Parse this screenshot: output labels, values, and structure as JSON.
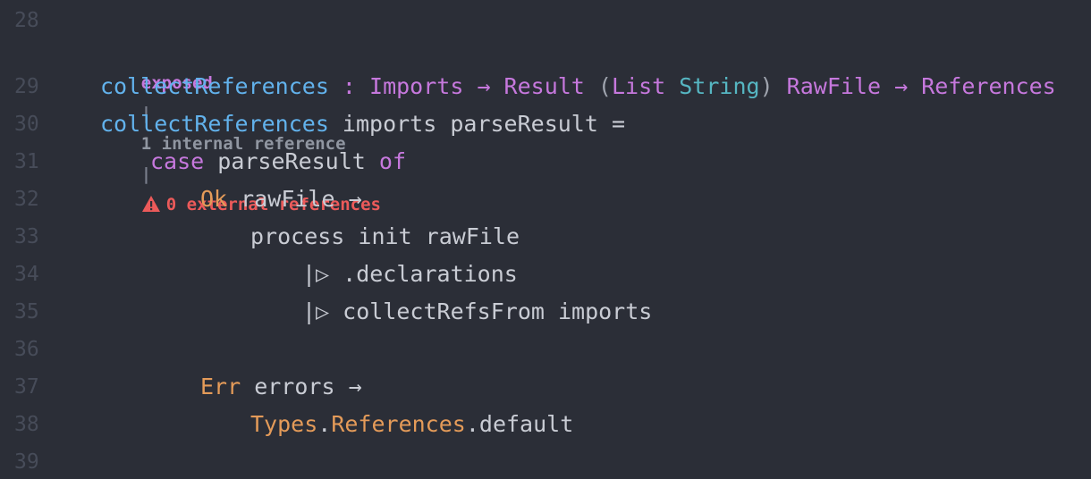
{
  "line_numbers": [
    "28",
    "29",
    "30",
    "31",
    "32",
    "33",
    "34",
    "35",
    "36",
    "37",
    "38",
    "39"
  ],
  "code_lens": {
    "exposed": "exposed",
    "separator": "|",
    "internal": "1 internal reference",
    "external": "0 external references",
    "warning_icon": "warning-triangle-icon",
    "warning_color": "#ec5a5a"
  },
  "code": {
    "l29": [
      "collectReferences",
      " : ",
      "Imports",
      " → ",
      "Result",
      " (",
      "List",
      " ",
      "String",
      ") ",
      "RawFile",
      " → ",
      "References"
    ],
    "l30": [
      "collectReferences",
      " imports parseResult ="
    ],
    "l31": [
      "case",
      " parseResult ",
      "of"
    ],
    "l32": [
      "Ok",
      " rawFile →"
    ],
    "l33": [
      "process init rawFile"
    ],
    "l34": [
      "|▷ .declarations"
    ],
    "l35": [
      "|▷ collectRefsFrom imports"
    ],
    "l37": [
      "Err",
      " errors →"
    ],
    "l38": [
      "Types",
      ".",
      "References",
      ".default"
    ]
  },
  "colors": {
    "background": "#2b2e37",
    "function": "#62b2ec",
    "type": "#c678dd",
    "keyword": "#c678dd",
    "constructor": "#e49b59",
    "builtin_type": "#56b6c2",
    "text": "#c9ccd4",
    "line_number": "#474c59"
  }
}
